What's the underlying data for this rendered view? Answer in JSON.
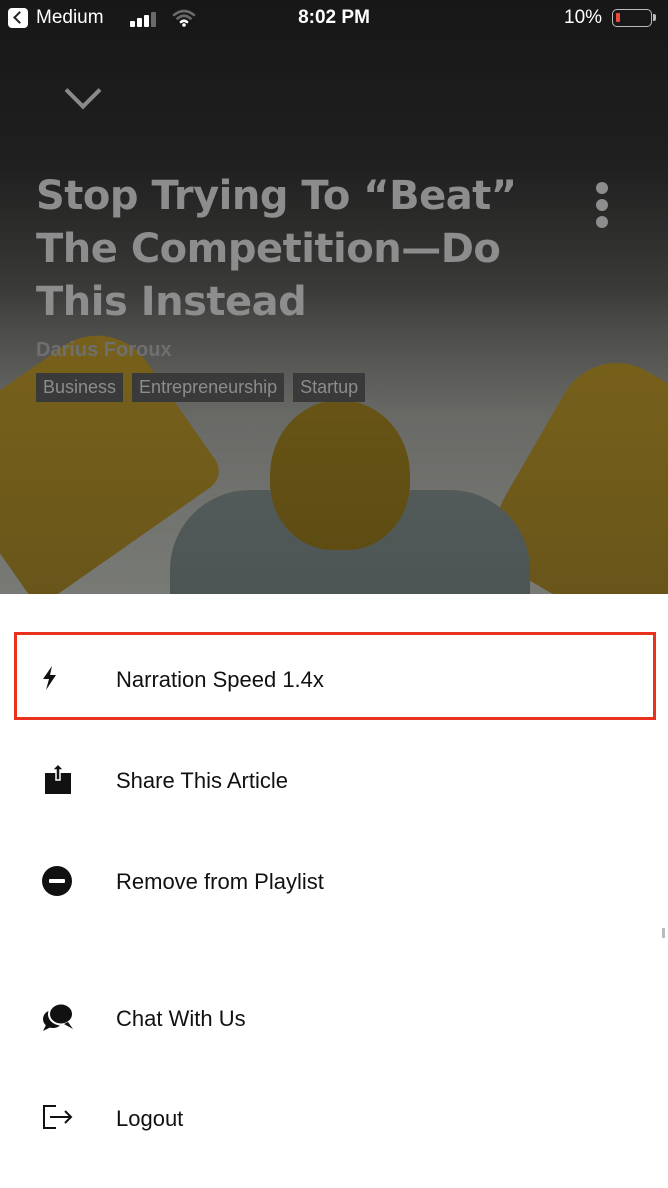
{
  "status_bar": {
    "carrier": "Medium",
    "time": "8:02 PM",
    "battery_percent": "10%"
  },
  "article": {
    "title_lines": [
      "Stop Trying To “Beat”",
      "The Competition—Do",
      "This Instead"
    ],
    "author": "Darius Foroux",
    "tags": [
      "Business",
      "Entrepreneurship",
      "Startup"
    ]
  },
  "menu": {
    "items": [
      {
        "label": "Narration Speed 1.4x",
        "icon": "lightning-icon"
      },
      {
        "label": "Share This Article",
        "icon": "share-icon"
      },
      {
        "label": "Remove from Playlist",
        "icon": "minus-circle-icon"
      },
      {
        "label": "Chat With Us",
        "icon": "chat-bubbles-icon"
      },
      {
        "label": "Logout",
        "icon": "logout-icon"
      }
    ]
  },
  "colors": {
    "highlight_border": "#e8321e",
    "hero_text": "#8d8d8d",
    "menu_text": "#111111"
  }
}
